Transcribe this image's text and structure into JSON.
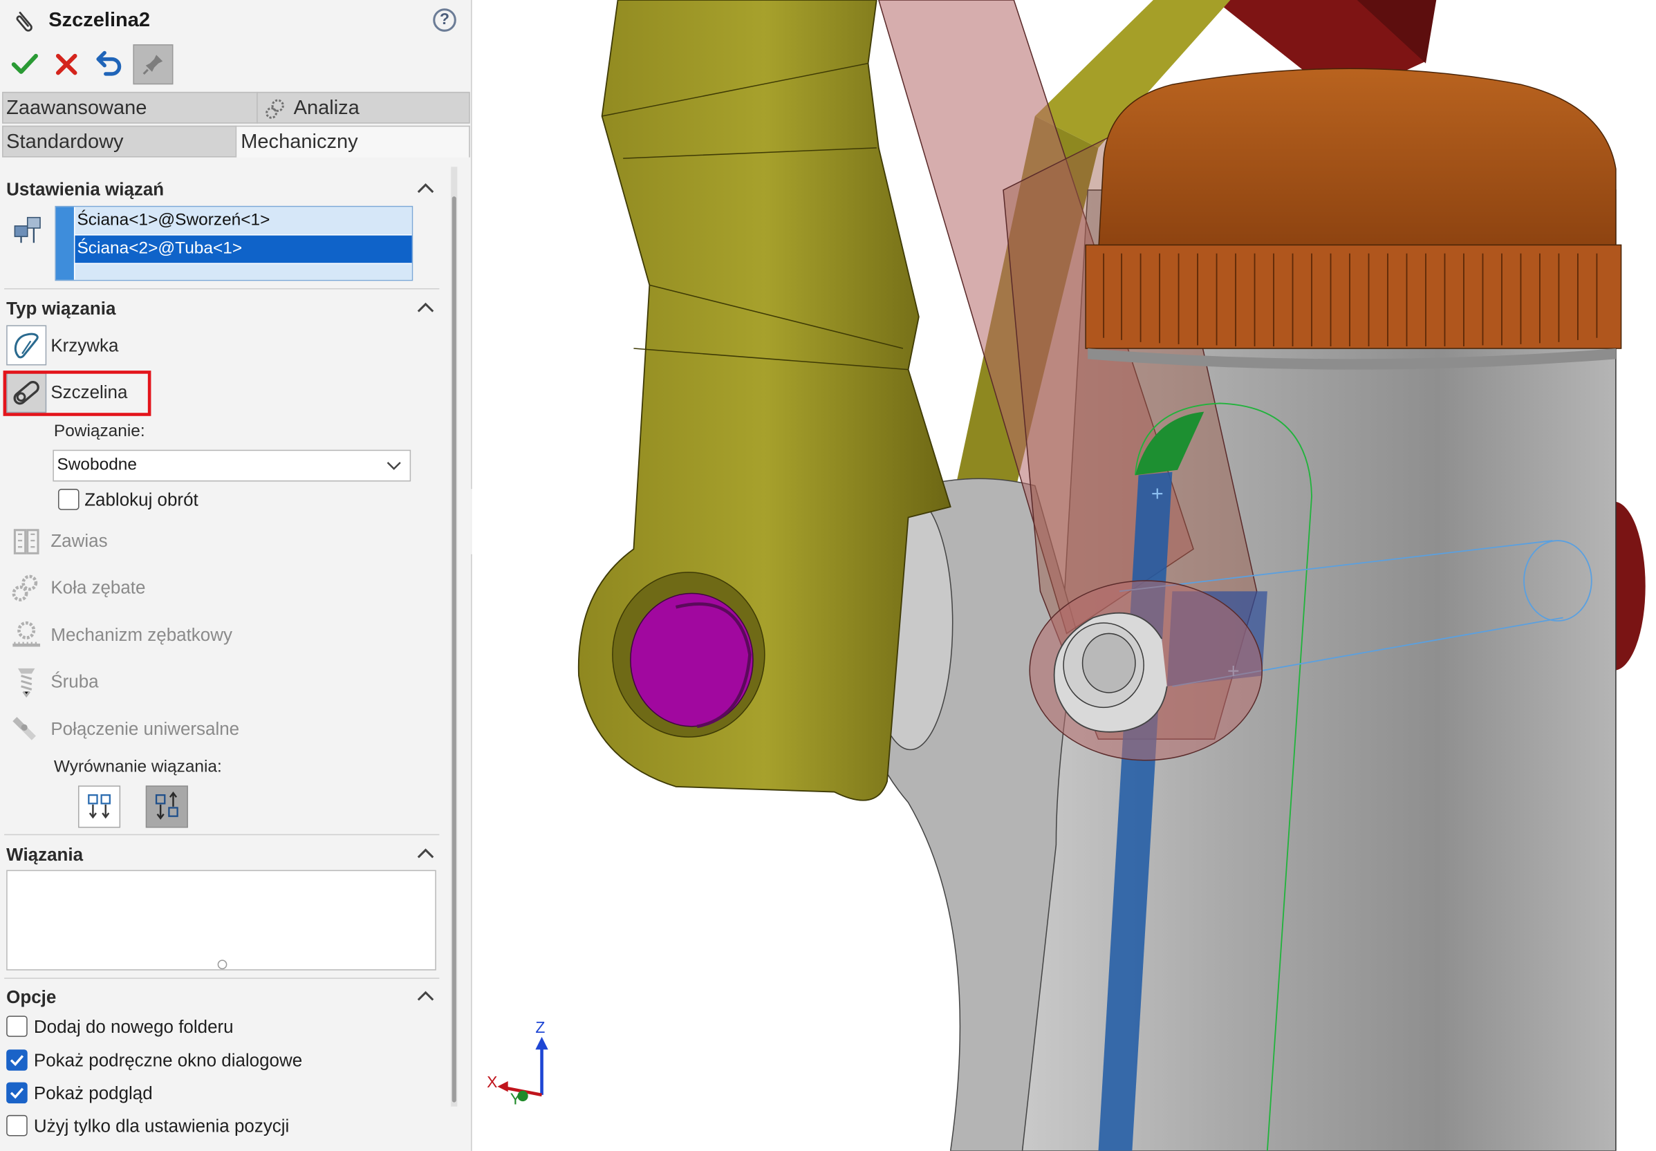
{
  "header": {
    "title": "Szczelina2",
    "help_glyph": "?"
  },
  "tabs": {
    "row1": [
      {
        "label": "Zaawansowane"
      },
      {
        "label": "Analiza",
        "icon": "gears-icon"
      }
    ],
    "row2": [
      {
        "label": "Standardowy"
      },
      {
        "label": "Mechaniczny"
      }
    ]
  },
  "mate_settings": {
    "heading": "Ustawienia wiązań",
    "selections": [
      "Ściana<1>@Sworzeń<1>",
      "Ściana<2>@Tuba<1>"
    ]
  },
  "mate_type": {
    "heading": "Typ wiązania",
    "items": [
      {
        "label": "Krzywka",
        "icon": "cam-icon",
        "enabled": true
      },
      {
        "label": "Szczelina",
        "icon": "slot-icon",
        "enabled": true,
        "highlighted": true
      },
      {
        "label": "Zawias",
        "icon": "hinge-icon",
        "enabled": false
      },
      {
        "label": "Koła zębate",
        "icon": "gear-icon",
        "enabled": false
      },
      {
        "label": "Mechanizm zębatkowy",
        "icon": "rack-pinion-icon",
        "enabled": false
      },
      {
        "label": "Śruba",
        "icon": "screw-icon",
        "enabled": false
      },
      {
        "label": "Połączenie uniwersalne",
        "icon": "universal-joint-icon",
        "enabled": false
      }
    ],
    "constraint_label": "Powiązanie:",
    "constraint_value": "Swobodne",
    "lock_rotation_label": "Zablokuj obrót",
    "lock_rotation_checked": false,
    "alignment_label": "Wyrównanie wiązania:",
    "alignment_active": "anti-aligned"
  },
  "mates": {
    "heading": "Wiązania"
  },
  "options": {
    "heading": "Opcje",
    "items": [
      {
        "label": "Dodaj do nowego folderu",
        "checked": false
      },
      {
        "label": "Pokaż podręczne okno dialogowe",
        "checked": true
      },
      {
        "label": "Pokaż podgląd",
        "checked": true
      },
      {
        "label": "Użyj tylko dla ustawienia pozycji",
        "checked": false
      }
    ]
  },
  "viewport": {
    "axes": {
      "x": "X",
      "y": "Y",
      "z": "Z"
    },
    "colors": {
      "link_yellow": "#a8a22a",
      "link_red": "#8b1c1c",
      "pin_magenta": "#9a0f9c",
      "cap_orange": "#b4601e",
      "tube_grey": "#a7a7a7",
      "slot_green": "#1fa83a",
      "selection_blue": "#1c5aa8"
    }
  }
}
